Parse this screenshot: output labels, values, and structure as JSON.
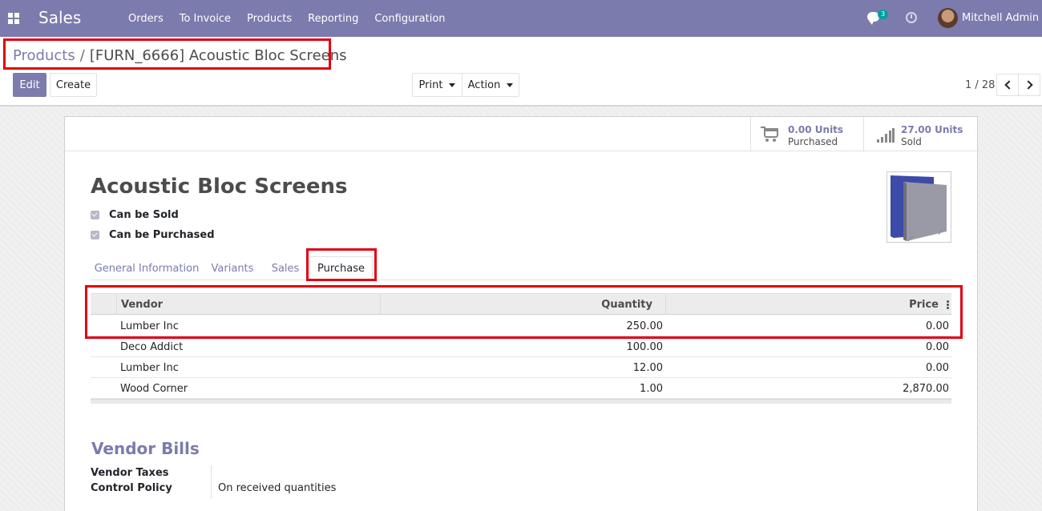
{
  "navbar": {
    "app_name": "Sales",
    "menu": [
      "Orders",
      "To Invoice",
      "Products",
      "Reporting",
      "Configuration"
    ],
    "chat_count": "3",
    "user_name": "Mitchell Admin",
    "bg_color": "#7c7bad"
  },
  "breadcrumb": {
    "parent": "Products",
    "separator": "/",
    "current": "[FURN_6666] Acoustic Bloc Screens"
  },
  "control_panel": {
    "edit_label": "Edit",
    "create_label": "Create",
    "print_label": "Print",
    "action_label": "Action",
    "pager": "1 / 28"
  },
  "stat_buttons": {
    "purchased": {
      "value": "0.00 Units",
      "label": "Purchased",
      "icon": "shopping-cart-icon"
    },
    "sold": {
      "value": "27.00 Units",
      "label": "Sold",
      "icon": "signal-bars-icon"
    }
  },
  "product": {
    "name": "Acoustic Bloc Screens",
    "can_be_sold_label": "Can be Sold",
    "can_be_purchased_label": "Can be Purchased",
    "can_be_sold": true,
    "can_be_purchased": true
  },
  "tabs": [
    "General Information",
    "Variants",
    "Sales",
    "Purchase"
  ],
  "active_tab": "Purchase",
  "vendor_table": {
    "headers": {
      "vendor": "Vendor",
      "quantity": "Quantity",
      "price": "Price"
    },
    "rows": [
      {
        "vendor": "Lumber Inc",
        "quantity": "250.00",
        "price": "0.00"
      },
      {
        "vendor": "Deco Addict",
        "quantity": "100.00",
        "price": "0.00"
      },
      {
        "vendor": "Lumber Inc",
        "quantity": "12.00",
        "price": "0.00"
      },
      {
        "vendor": "Wood Corner",
        "quantity": "1.00",
        "price": "2,870.00"
      }
    ]
  },
  "vendor_bills": {
    "title": "Vendor Bills",
    "taxes_label": "Vendor Taxes",
    "taxes_value": "",
    "control_policy_label": "Control Policy",
    "control_policy_value": "On received quantities"
  },
  "colors": {
    "accent": "#7c7bad",
    "highlight": "#e30010"
  }
}
